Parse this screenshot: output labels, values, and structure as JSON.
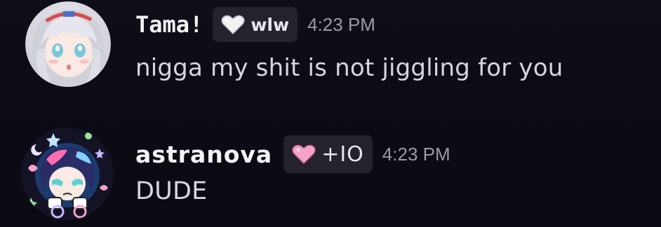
{
  "messages": [
    {
      "username": "Tama!",
      "tag": {
        "icon": "white-heart-icon",
        "label": "wlw",
        "color": "#f2f2f2"
      },
      "timestamp": "4:23 PM",
      "content": "nigga my shit is not jiggling for you",
      "avatar": "anime-girl-silver-hair-avatar"
    },
    {
      "username": "astranova",
      "tag": {
        "icon": "pink-heart-icon",
        "label": "+IO",
        "color": "#f7a3c9"
      },
      "timestamp": "4:23 PM",
      "content": "DUDE",
      "avatar": "anime-girl-stars-avatar"
    }
  ],
  "theme": {
    "background": "#0d0c16",
    "tag_background": "#24232d",
    "username_color": "#f2f3f5",
    "timestamp_color": "#9a9ba6",
    "text_color": "#d6d7de"
  }
}
